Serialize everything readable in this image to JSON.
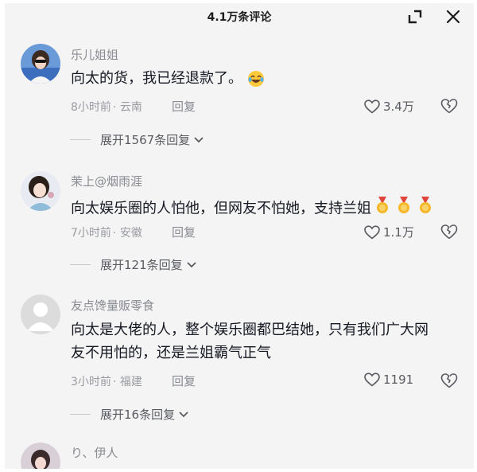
{
  "header": {
    "title": "4.1万条评论"
  },
  "comments": [
    {
      "username": "乐儿姐姐",
      "text": "向太的货，我已经退款了。",
      "time": "8小时前",
      "location": "· 云南",
      "reply_label": "回复",
      "likes": "3.4万",
      "expand_label": "展开1567条回复",
      "emoji": "laughing-crying-emoji"
    },
    {
      "username": "茉上@烟雨涯",
      "text": "向太娱乐圈的人怕他，但网友不怕她，支持兰姐",
      "time": "7小时前",
      "location": "· 安徽",
      "reply_label": "回复",
      "likes": "1.1万",
      "expand_label": "展开121条回复",
      "emoji": "medal-emoji"
    },
    {
      "username": "友点馋量贩零食",
      "text_line1": "向太是大佬的人，整个娱乐圈都巴结她，只有我们广大网",
      "text_line2": "友不用怕的，还是兰姐霸气正气",
      "time": "3小时前",
      "location": "· 福建",
      "reply_label": "回复",
      "likes": "1191",
      "expand_label": "展开16条回复"
    },
    {
      "username": "り、伊人"
    }
  ],
  "colors": {
    "panel_bg": "#f4f4f4",
    "secondary": "#8a8b91",
    "primary_text": "#161823"
  }
}
